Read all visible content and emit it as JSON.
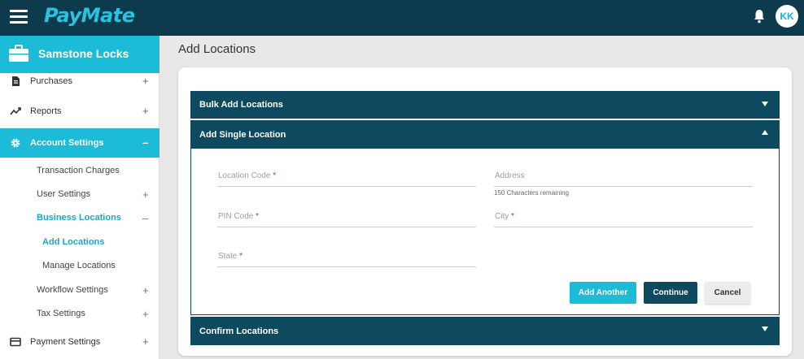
{
  "header": {
    "logo_text": "PayMate",
    "avatar_initials": "KK",
    "bar_color": "#0e3a4d",
    "accent_color": "#1cbcd8"
  },
  "sidebar": {
    "org_name": "Samstone Locks",
    "items": [
      {
        "label": "Purchases",
        "icon": "document-icon",
        "sign": "+"
      },
      {
        "label": "Reports",
        "icon": "trend-icon",
        "sign": "+"
      },
      {
        "label": "Account Settings",
        "icon": "gear-icon",
        "sign": "–",
        "active": true
      },
      {
        "label": "Payment Settings",
        "icon": "card-icon",
        "sign": "+"
      }
    ],
    "sub_items": [
      {
        "label": "Transaction Charges",
        "sign": ""
      },
      {
        "label": "User Settings",
        "sign": "+"
      },
      {
        "label": "Business Locations",
        "sign": "–",
        "active": true
      },
      {
        "label": "Add Locations",
        "sign": "",
        "active": true
      },
      {
        "label": "Manage Locations",
        "sign": ""
      },
      {
        "label": "Workflow Settings",
        "sign": "+"
      },
      {
        "label": "Tax Settings",
        "sign": "+"
      }
    ]
  },
  "main": {
    "title": "Add Locations",
    "sections": [
      {
        "title": "Bulk Add Locations",
        "expanded": false
      },
      {
        "title": "Add Single Location",
        "expanded": true
      },
      {
        "title": "Confirm Locations",
        "expanded": false
      }
    ],
    "form": {
      "location_code": {
        "placeholder": "Location Code",
        "required": "*",
        "value": ""
      },
      "address": {
        "placeholder": "Address",
        "value": "",
        "hint": "150 Characters remaining"
      },
      "pin_code": {
        "placeholder": "PIN Code",
        "required": "*",
        "value": ""
      },
      "city": {
        "placeholder": "City",
        "required": "*",
        "value": ""
      },
      "state": {
        "placeholder": "State",
        "required": "*",
        "value": ""
      }
    },
    "buttons": {
      "add_another": "Add Another",
      "continue": "Continue",
      "cancel": "Cancel"
    }
  }
}
